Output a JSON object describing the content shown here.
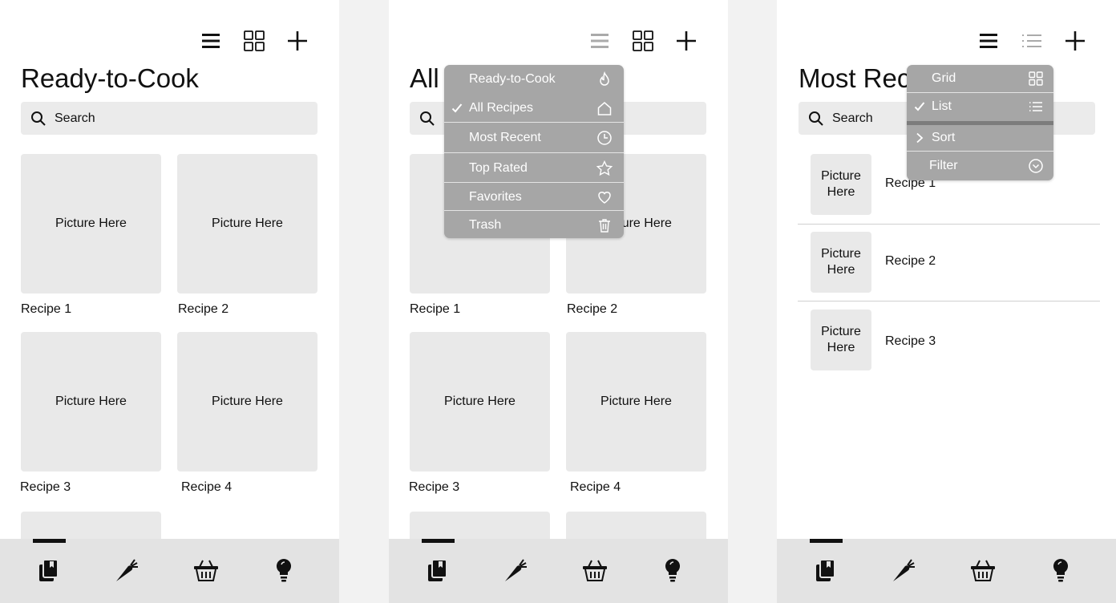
{
  "common": {
    "search_placeholder": "Search",
    "picture_placeholder": "Picture Here",
    "recipes": [
      "Recipe 1",
      "Recipe 2",
      "Recipe 3",
      "Recipe 4"
    ],
    "nav_items": [
      "recipe-book-icon",
      "carrot-icon",
      "basket-icon",
      "lightbulb-icon"
    ]
  },
  "screen1": {
    "title": "Ready-to-Cook"
  },
  "screen2": {
    "title": "All",
    "menu": [
      {
        "label": "Ready-to-Cook",
        "icon": "flame-icon",
        "checked": false
      },
      {
        "label": "All Recipes",
        "icon": "home-icon",
        "checked": true
      },
      {
        "label": "Most Recent",
        "icon": "clock-icon",
        "checked": false
      },
      {
        "label": "Top Rated",
        "icon": "star-icon",
        "checked": false
      },
      {
        "label": "Favorites",
        "icon": "heart-icon",
        "checked": false
      },
      {
        "label": "Trash",
        "icon": "trash-icon",
        "checked": false
      }
    ]
  },
  "screen3": {
    "title": "Most Rec",
    "menu": [
      {
        "label": "Grid",
        "icon": "grid-icon",
        "checked": false
      },
      {
        "label": "List",
        "icon": "list-icon",
        "checked": true
      },
      {
        "label": "Sort",
        "icon": "chevron-right-icon",
        "checked": false
      },
      {
        "label": "Filter",
        "icon": "chevron-down-circle-icon",
        "checked": false
      }
    ],
    "list_picture_placeholder": [
      "Picture",
      "Here"
    ],
    "recipes": [
      "Recipe 1",
      "Recipe 2",
      "Recipe 3"
    ]
  },
  "colors": {
    "tile_bg": "#e9e9e9",
    "menu_bg": "#a6a6a6",
    "nav_bg": "#e3e3e3"
  }
}
